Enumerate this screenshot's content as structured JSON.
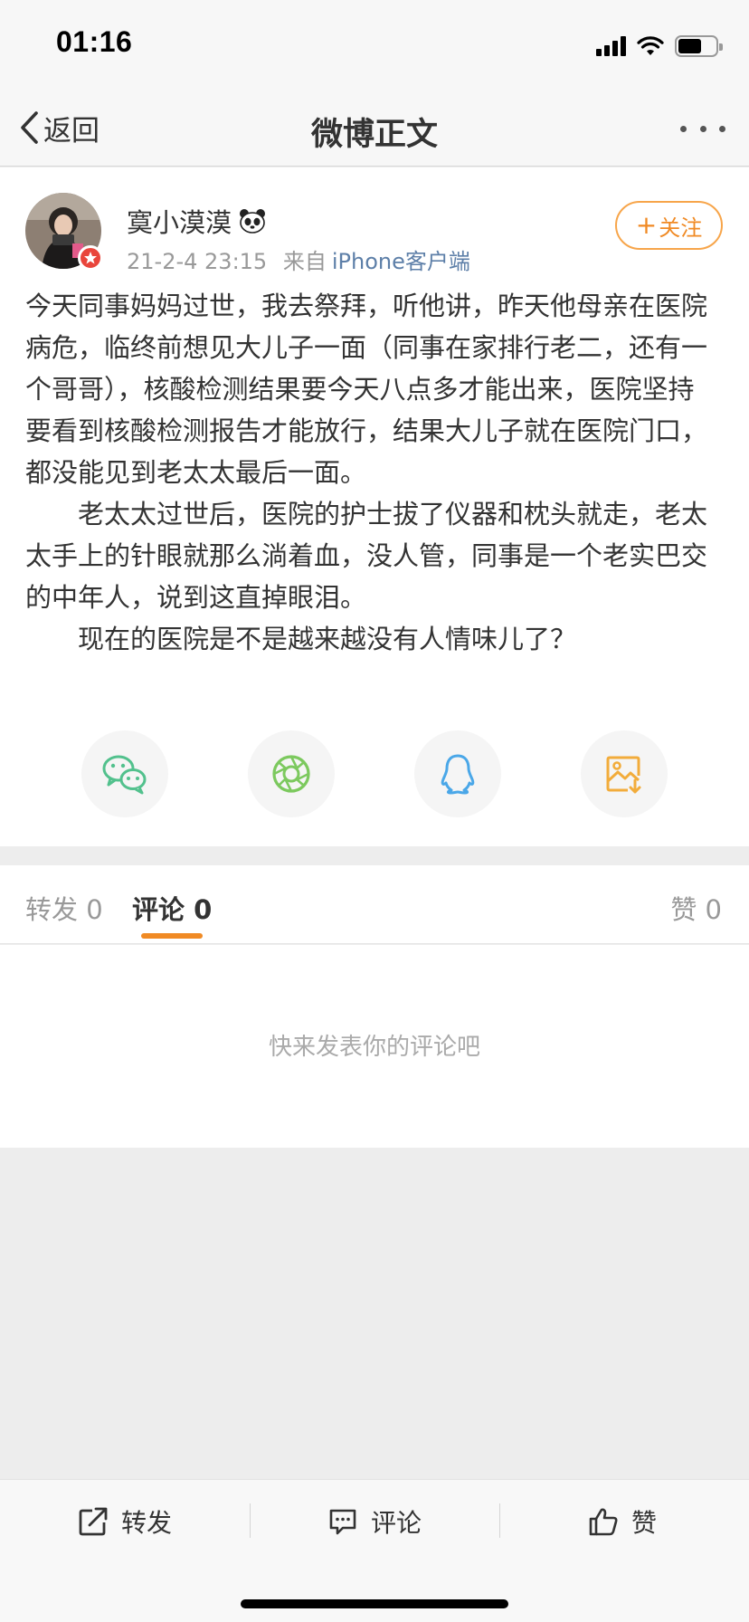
{
  "status_bar": {
    "time": "01:16"
  },
  "nav": {
    "back_label": "返回",
    "title": "微博正文"
  },
  "post": {
    "username": "寞小漠漠",
    "date": "21-2-4 23:15",
    "source_prefix": "来自",
    "source": "iPhone客户端",
    "follow_label": "关注",
    "paragraphs": [
      "今天同事妈妈过世，我去祭拜，听他讲，昨天他母亲在医院病危，临终前想见大儿子一面（同事在家排行老二，还有一个哥哥），核酸检测结果要今天八点多才能出来，医院坚持要看到核酸检测报告才能放行，结果大儿子就在医院门口，都没能见到老太太最后一面。",
      "老太太过世后，医院的护士拔了仪器和枕头就走，老太太手上的针眼就那么淌着血，没人管，同事是一个老实巴交的中年人，说到这直掉眼泪。",
      "现在的医院是不是越来越没有人情味儿了？"
    ],
    "share_icons": [
      "wechat-icon",
      "moments-icon",
      "qq-icon",
      "save-image-icon"
    ]
  },
  "tabs": {
    "repost": "转发 0",
    "comment": "评论 0",
    "like": "赞 0"
  },
  "comments": {
    "empty_text": "快来发表你的评论吧"
  },
  "toolbar": {
    "repost_label": "转发",
    "comment_label": "评论",
    "like_label": "赞"
  },
  "colors": {
    "accent": "#f08a24",
    "link": "#5d7fa8",
    "verified": "#e9453b"
  }
}
